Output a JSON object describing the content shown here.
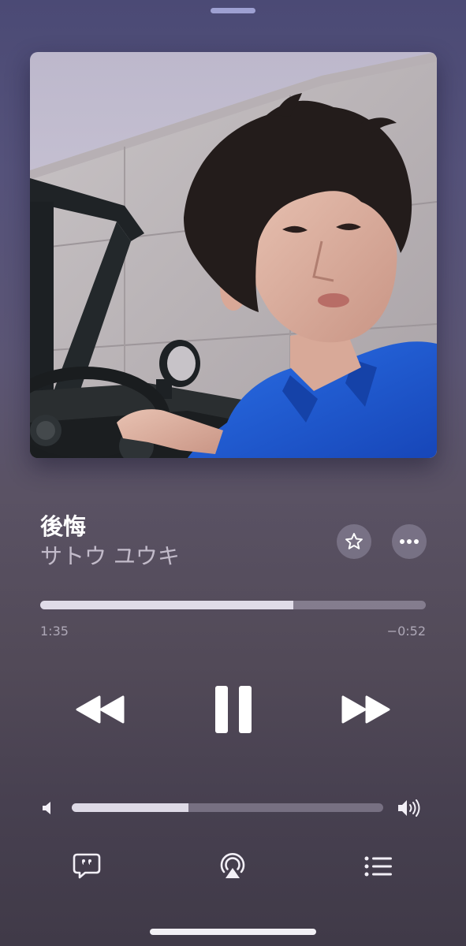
{
  "now_playing": {
    "title": "後悔",
    "artist": "サトウ ユウキ",
    "progress_fraction": 0.656,
    "time_elapsed": "1:35",
    "time_remaining": "−0:52",
    "volume_fraction": 0.375,
    "is_playing": true
  },
  "icons": {
    "favorite": "star-icon",
    "more": "ellipsis-icon",
    "rewind": "rewind-icon",
    "pause": "pause-icon",
    "forward": "fast-forward-icon",
    "volume_low": "speaker-low-icon",
    "volume_high": "speaker-high-icon",
    "lyrics": "lyrics-bubble-icon",
    "airplay": "airplay-icon",
    "queue": "queue-list-icon"
  },
  "colors": {
    "background_top": "#4b4a75",
    "background_bottom": "#403a48",
    "grabber": "#9ea0d2",
    "shirt_blue": "#1f5fd2"
  }
}
